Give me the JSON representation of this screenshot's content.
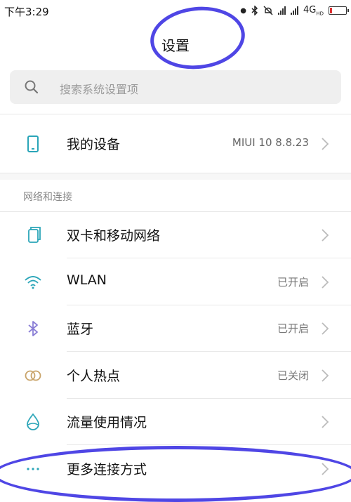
{
  "status_bar": {
    "time": "下午3:29",
    "network": "4G",
    "network_sub": "HD"
  },
  "header": {
    "title": "设置"
  },
  "search": {
    "placeholder": "搜索系统设置项"
  },
  "my_device": {
    "label": "我的设备",
    "value": "MIUI 10 8.8.23"
  },
  "section_network": {
    "title": "网络和连接",
    "items": [
      {
        "label": "双卡和移动网络",
        "value": "",
        "icon": "sim-card-icon"
      },
      {
        "label": "WLAN",
        "value": "已开启",
        "icon": "wifi-icon"
      },
      {
        "label": "蓝牙",
        "value": "已开启",
        "icon": "bluetooth-icon"
      },
      {
        "label": "个人热点",
        "value": "已关闭",
        "icon": "hotspot-icon"
      },
      {
        "label": "流量使用情况",
        "value": "",
        "icon": "data-usage-icon"
      },
      {
        "label": "更多连接方式",
        "value": "",
        "icon": "more-dots-icon"
      }
    ]
  },
  "colors": {
    "accent_icon": "#2aa5b8",
    "bluetooth_icon": "#8b7fd6",
    "hotspot_icon": "#c9a46a",
    "annotation": "#4f46e5"
  }
}
